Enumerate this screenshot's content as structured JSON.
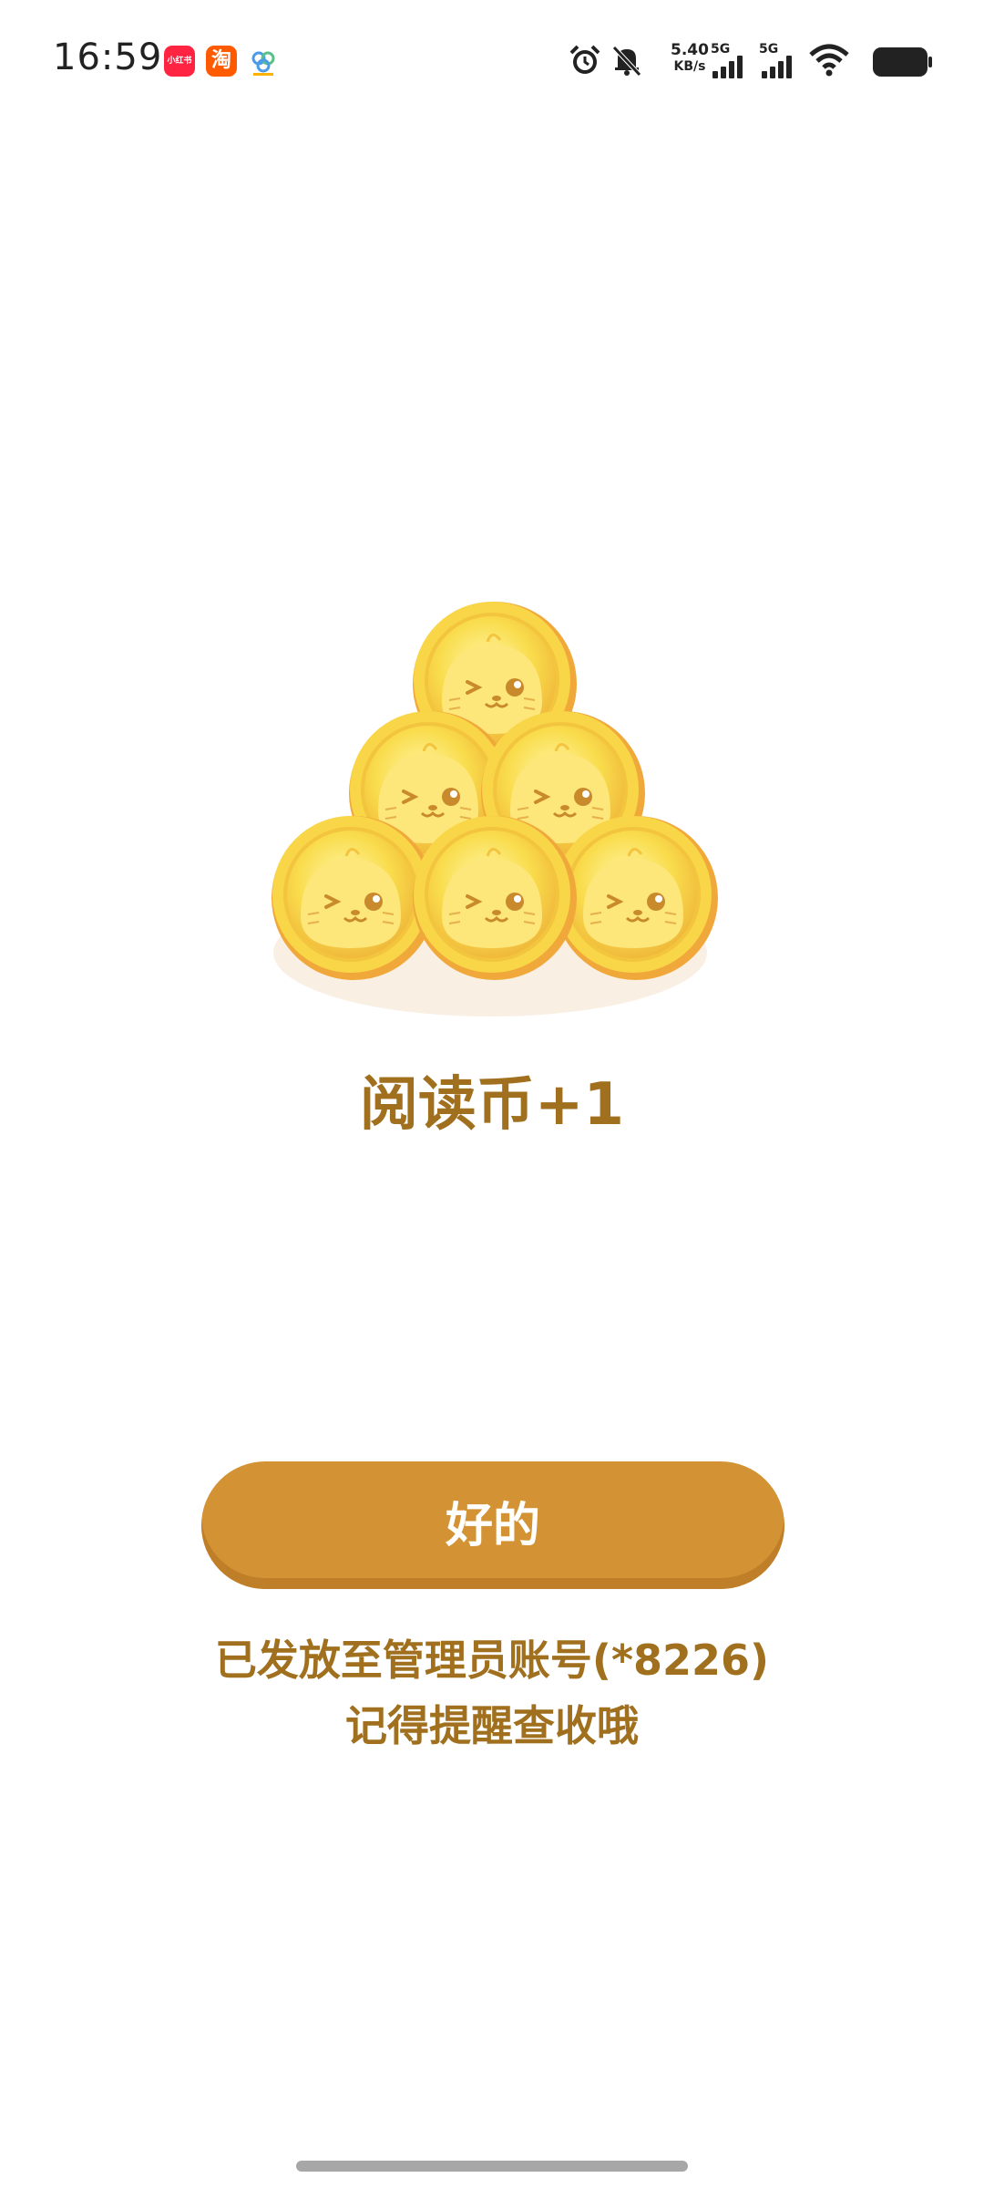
{
  "status_bar": {
    "time": "16:59",
    "app_icons": [
      {
        "name": "xiaohongshu-icon",
        "glyph": "小红书",
        "color": "#ff2442"
      },
      {
        "name": "taobao-icon",
        "glyph": "淘",
        "color": "#ff5a00"
      },
      {
        "name": "cloud-app-icon",
        "glyph": "",
        "color": "#4a9be8"
      }
    ],
    "net_speed": "5.40",
    "net_speed_unit": "KB/s",
    "signal_1_label": "5G",
    "signal_2_label": "5G",
    "icons": [
      "alarm-icon",
      "mute-bell-icon",
      "wifi-icon",
      "battery-icon"
    ]
  },
  "reward": {
    "title": "阅读币+1",
    "coin_color": "#f8d647"
  },
  "button": {
    "label": "好的"
  },
  "notice": {
    "line1": "已发放至管理员账号(*8226)",
    "line2": "记得提醒查收哦"
  },
  "colors": {
    "accent": "#d39234",
    "text": "#a0701f"
  }
}
